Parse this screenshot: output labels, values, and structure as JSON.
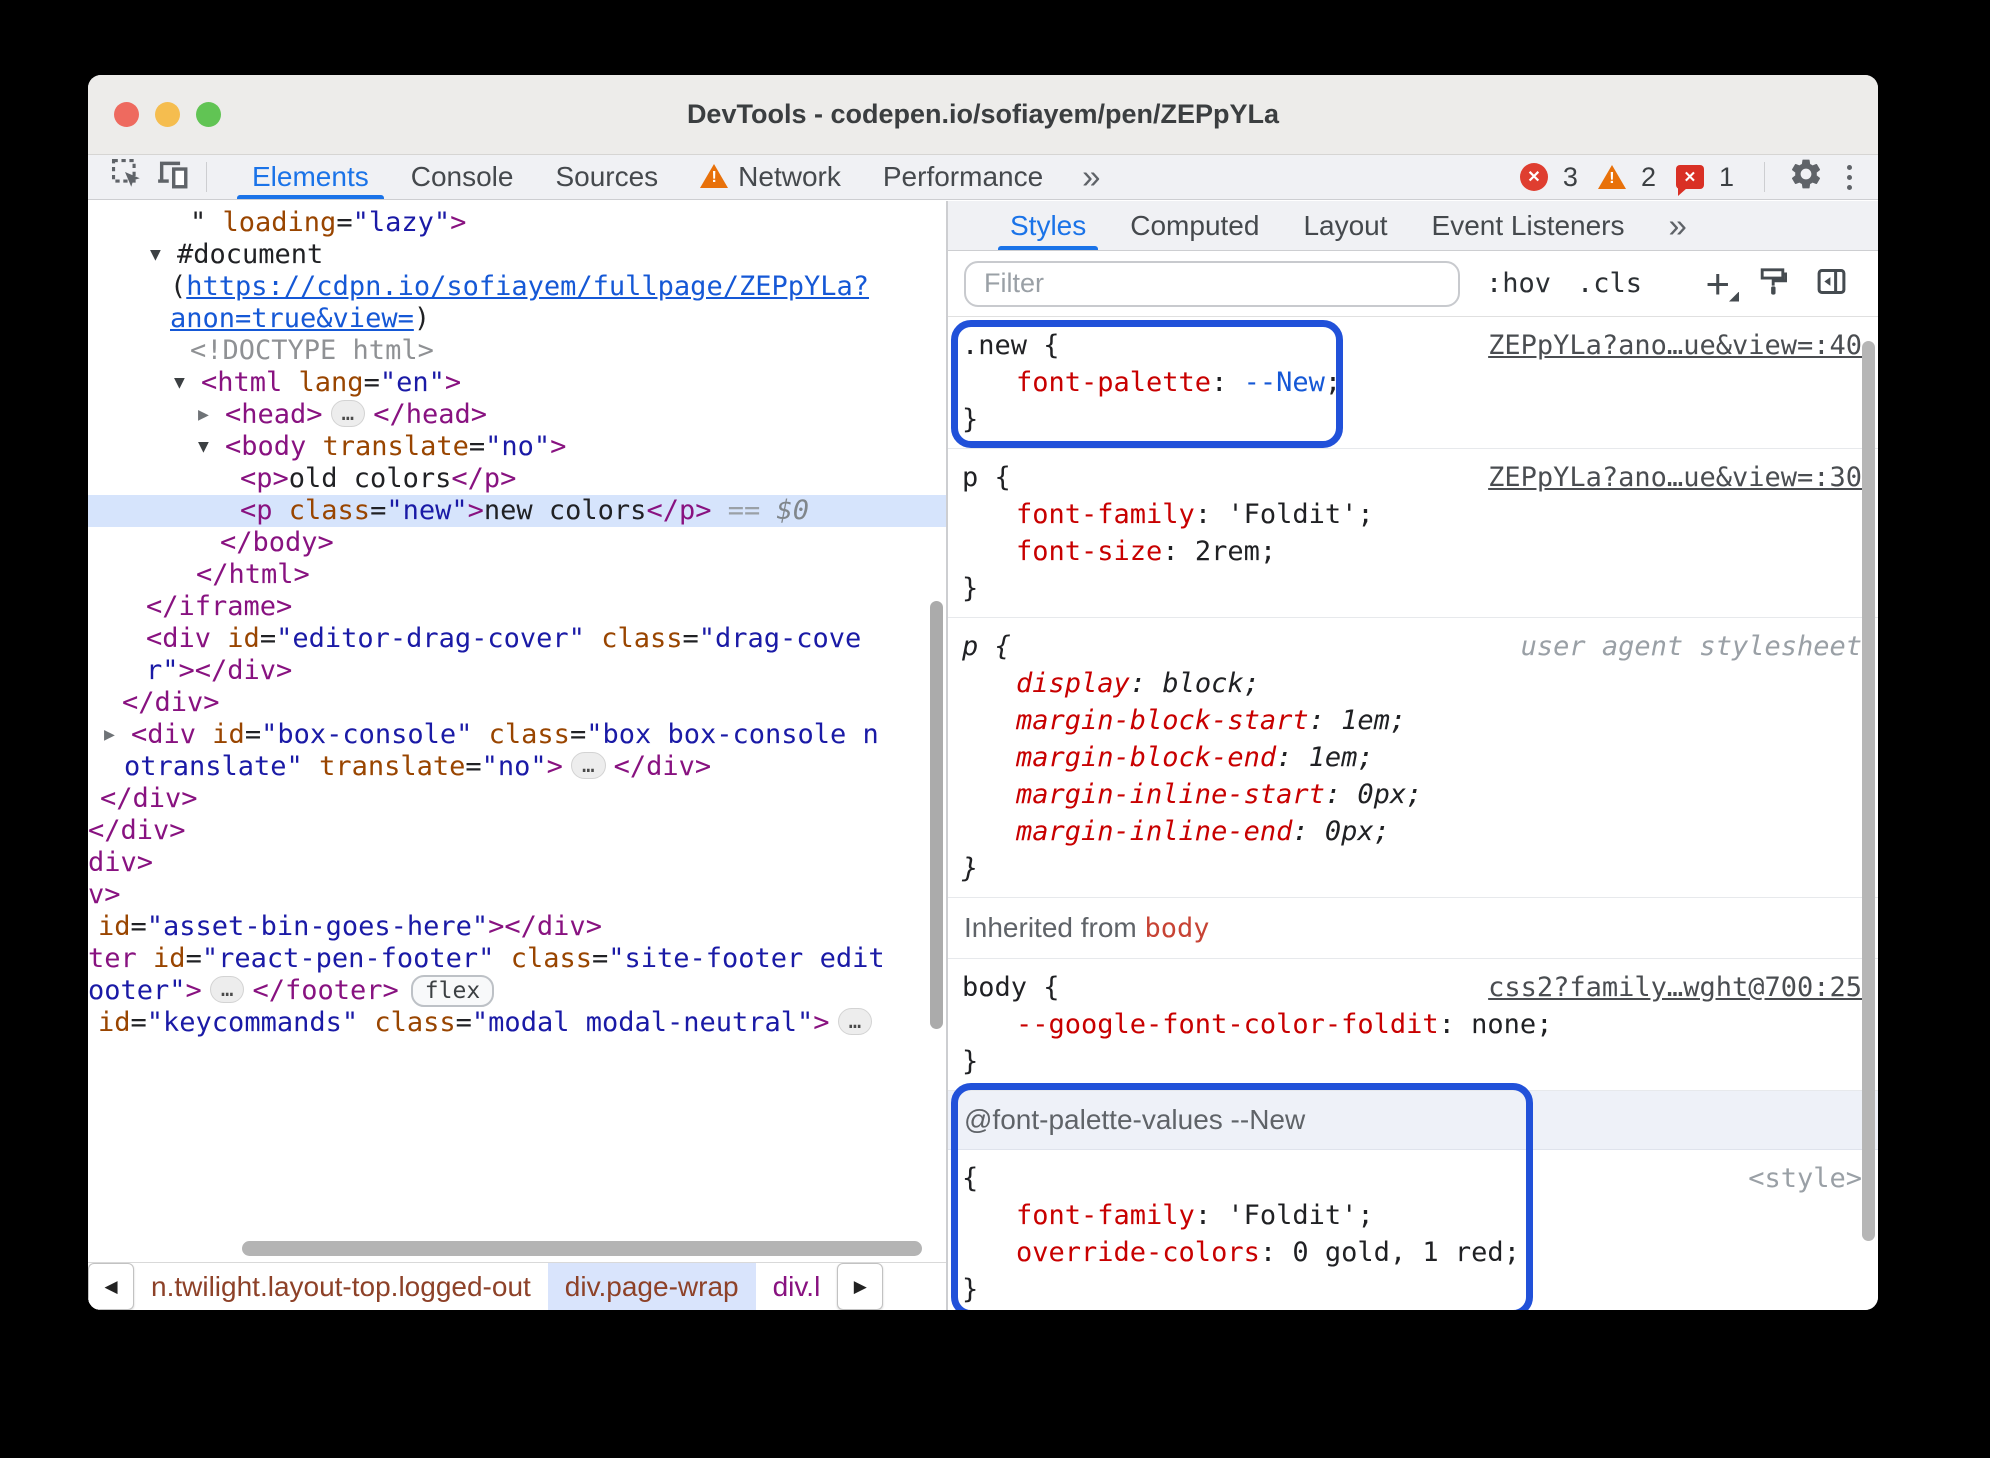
{
  "window": {
    "title": "DevTools - codepen.io/sofiayem/pen/ZEPpYLa"
  },
  "toolbar": {
    "tabs": [
      {
        "label": "Elements",
        "active": true
      },
      {
        "label": "Console"
      },
      {
        "label": "Sources"
      },
      {
        "label": "Network",
        "warning": true
      },
      {
        "label": "Performance"
      }
    ],
    "more_tabs_icon": "»",
    "error_count": "3",
    "warning_count": "2",
    "issue_count": "1"
  },
  "dom_panel": {
    "lines": [
      {
        "ind": 102,
        "seg": [
          [
            "x",
            "\" "
          ],
          [
            "n",
            "loading"
          ],
          [
            "x",
            "="
          ],
          [
            "v",
            "\"lazy\""
          ],
          [
            "t",
            ">"
          ]
        ]
      },
      {
        "ind": 62,
        "seg": [
          [
            "a",
            "▼"
          ],
          [
            "x",
            "#document"
          ]
        ]
      },
      {
        "ind": 82,
        "seg": [
          [
            "x",
            "("
          ],
          [
            "L",
            "https://cdpn.io/sofiayem/fullpage/ZEPpYLa?"
          ]
        ]
      },
      {
        "ind": 82,
        "seg": [
          [
            "L",
            "anon=true&view="
          ],
          [
            "x",
            ")"
          ]
        ]
      },
      {
        "ind": 102,
        "seg": [
          [
            "g",
            "<!DOCTYPE html>"
          ]
        ]
      },
      {
        "ind": 86,
        "seg": [
          [
            "a",
            "▼"
          ],
          [
            "t",
            "<html"
          ],
          [
            "n",
            " lang"
          ],
          [
            "x",
            "="
          ],
          [
            "v",
            "\"en\""
          ],
          [
            "t",
            ">"
          ]
        ]
      },
      {
        "ind": 110,
        "seg": [
          [
            "A",
            "▶"
          ],
          [
            "t",
            "<head>"
          ],
          [
            "P",
            "…"
          ],
          [
            "t",
            "</head>"
          ]
        ]
      },
      {
        "ind": 110,
        "seg": [
          [
            "a",
            "▼"
          ],
          [
            "t",
            "<body"
          ],
          [
            "n",
            " translate"
          ],
          [
            "x",
            "="
          ],
          [
            "v",
            "\"no\""
          ],
          [
            "t",
            ">"
          ]
        ]
      },
      {
        "ind": 152,
        "seg": [
          [
            "t",
            "<p>"
          ],
          [
            "x",
            "old colors"
          ],
          [
            "t",
            "</p>"
          ]
        ]
      },
      {
        "ind": 152,
        "sel": true,
        "seg": [
          [
            "t",
            "<p"
          ],
          [
            "n",
            " class"
          ],
          [
            "x",
            "="
          ],
          [
            "v",
            "\"new\""
          ],
          [
            "t",
            ">"
          ],
          [
            "x",
            "new colors"
          ],
          [
            "t",
            "</p>"
          ],
          [
            "E",
            " == "
          ],
          [
            "D",
            "$0"
          ]
        ]
      },
      {
        "ind": 132,
        "seg": [
          [
            "t",
            "</body>"
          ]
        ]
      },
      {
        "ind": 108,
        "seg": [
          [
            "t",
            "</html>"
          ]
        ]
      },
      {
        "ind": 58,
        "seg": [
          [
            "t",
            "</iframe>"
          ]
        ]
      },
      {
        "ind": 58,
        "seg": [
          [
            "t",
            "<div"
          ],
          [
            "n",
            " id"
          ],
          [
            "x",
            "="
          ],
          [
            "v",
            "\"editor-drag-cover\""
          ],
          [
            "n",
            " class"
          ],
          [
            "x",
            "="
          ],
          [
            "v",
            "\"drag-cove"
          ]
        ]
      },
      {
        "ind": 58,
        "seg": [
          [
            "v",
            "r\""
          ],
          [
            "t",
            "></div>"
          ]
        ]
      },
      {
        "ind": 34,
        "seg": [
          [
            "t",
            "</div>"
          ]
        ]
      },
      {
        "ind": 16,
        "seg": [
          [
            "A",
            "▶"
          ],
          [
            "t",
            "<div"
          ],
          [
            "n",
            " id"
          ],
          [
            "x",
            "="
          ],
          [
            "v",
            "\"box-console\""
          ],
          [
            "n",
            " class"
          ],
          [
            "x",
            "="
          ],
          [
            "v",
            "\"box box-console n"
          ]
        ]
      },
      {
        "ind": 36,
        "seg": [
          [
            "v",
            "otranslate\""
          ],
          [
            "n",
            " translate"
          ],
          [
            "x",
            "="
          ],
          [
            "v",
            "\"no\""
          ],
          [
            "t",
            ">"
          ],
          [
            "P",
            "…"
          ],
          [
            "t",
            "</div>"
          ]
        ]
      },
      {
        "ind": 12,
        "seg": [
          [
            "t",
            "</div>"
          ]
        ]
      },
      {
        "ind": 0,
        "seg": [
          [
            "t",
            "</div>"
          ]
        ]
      },
      {
        "ind": 0,
        "seg": [
          [
            "t",
            "div>"
          ]
        ]
      },
      {
        "ind": 0,
        "seg": [
          [
            "t",
            "v>"
          ]
        ]
      },
      {
        "ind": 10,
        "seg": [
          [
            "n",
            "id"
          ],
          [
            "x",
            "="
          ],
          [
            "v",
            "\"asset-bin-goes-here\""
          ],
          [
            "t",
            "></div>"
          ]
        ]
      },
      {
        "ind": 0,
        "seg": [
          [
            "t",
            "ter"
          ],
          [
            "n",
            " id"
          ],
          [
            "x",
            "="
          ],
          [
            "v",
            "\"react-pen-footer\""
          ],
          [
            "n",
            " class"
          ],
          [
            "x",
            "="
          ],
          [
            "v",
            "\"site-footer edit"
          ]
        ]
      },
      {
        "ind": 0,
        "seg": [
          [
            "v",
            "ooter\""
          ],
          [
            "t",
            ">"
          ],
          [
            "P",
            "…"
          ],
          [
            "t",
            "</footer>"
          ],
          [
            "F",
            "flex"
          ]
        ]
      },
      {
        "ind": 10,
        "seg": [
          [
            "n",
            "id"
          ],
          [
            "x",
            "="
          ],
          [
            "v",
            "\"keycommands\""
          ],
          [
            "n",
            " class"
          ],
          [
            "x",
            "="
          ],
          [
            "v",
            "\"modal modal-neutral\""
          ],
          [
            "t",
            ">"
          ],
          [
            "P",
            "…"
          ]
        ]
      }
    ],
    "breadcrumbs": {
      "left_arrow": "◀",
      "right_arrow": "▶",
      "items": [
        {
          "label": "n.twilight.layout-top.logged-out",
          "color": "#8d4128"
        },
        {
          "label": "div.page-wrap",
          "color": "#8d4128",
          "selected": true
        },
        {
          "label": "div.l",
          "color": "#881280"
        }
      ]
    }
  },
  "styles_panel": {
    "tabs": [
      {
        "label": "Styles",
        "active": true
      },
      {
        "label": "Computed"
      },
      {
        "label": "Layout"
      },
      {
        "label": "Event Listeners"
      }
    ],
    "more_tabs_icon": "»",
    "filter_placeholder": "Filter",
    "pseudo_toggle": ":hov",
    "class_toggle": ".cls",
    "sections": [
      {
        "type": "rule",
        "boxed": true,
        "selector": ".new {",
        "close": "}",
        "link": "ZEPpYLa?ano…ue&view=:40",
        "props": [
          {
            "name": "font-palette",
            "value": "--New",
            "value_is_link": true
          }
        ]
      },
      {
        "type": "rule",
        "selector": "p {",
        "close": "}",
        "link": "ZEPpYLa?ano…ue&view=:30",
        "props": [
          {
            "name": "font-family",
            "value": "'Foldit'"
          },
          {
            "name": "font-size",
            "value": "2rem"
          }
        ]
      },
      {
        "type": "rule",
        "italic": true,
        "selector": "p {",
        "close": "}",
        "origin": "user agent stylesheet",
        "props": [
          {
            "name": "display",
            "value": "block"
          },
          {
            "name": "margin-block-start",
            "value": "1em"
          },
          {
            "name": "margin-block-end",
            "value": "1em"
          },
          {
            "name": "margin-inline-start",
            "value": "0px"
          },
          {
            "name": "margin-inline-end",
            "value": "0px"
          }
        ]
      },
      {
        "type": "inherited_header",
        "prefix": "Inherited from ",
        "node": "body"
      },
      {
        "type": "rule",
        "selector": "body {",
        "close": "}",
        "link": "css2?family…wght@700:25",
        "props": [
          {
            "name": "--google-font-color-foldit",
            "value": "none"
          }
        ]
      },
      {
        "type": "at_rule",
        "boxed": true,
        "header": "@font-palette-values --New",
        "selector": "{",
        "close": "}",
        "origin": "<style>",
        "props": [
          {
            "name": "font-family",
            "value": "'Foldit'"
          },
          {
            "name": "override-colors",
            "value": "0 gold, 1 red"
          }
        ]
      }
    ]
  },
  "colors": {
    "accent_blue": "#1a73e8",
    "callout_blue": "#2151d9",
    "tag": "#881280",
    "attr_name": "#994500",
    "attr_value": "#1a1aa6",
    "property": "#c80000",
    "link": "#1558d6",
    "selected_row_bg": "#d6e4fc",
    "error_red": "#df3e30",
    "warning_orange": "#e8710a",
    "issue_red": "#d93025"
  }
}
